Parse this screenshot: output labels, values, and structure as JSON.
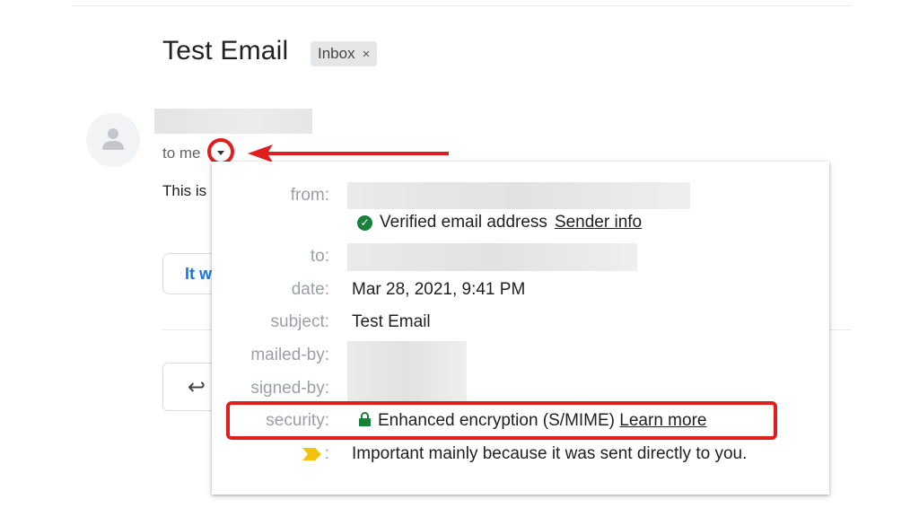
{
  "email": {
    "subject": "Test Email",
    "label_chip": "Inbox",
    "label_chip_close": "×",
    "to_me_label": "to me",
    "body_preview": "This is",
    "quick_reply_chip": "It w",
    "reply_icon_glyph": "↩"
  },
  "details": {
    "from_label": "from:",
    "verified_text": "Verified email address",
    "sender_info_link": "Sender info",
    "to_label": "to:",
    "date_label": "date:",
    "date_value": "Mar 28, 2021, 9:41 PM",
    "subject_label": "subject:",
    "subject_value": "Test Email",
    "mailed_by_label": "mailed-by:",
    "signed_by_label": "signed-by:",
    "security_label": "security:",
    "security_value": "Enhanced encryption (S/MIME)",
    "learn_more_link": "Learn more",
    "importance_colon": ":",
    "importance_text": "Important mainly because it was sent directly to you."
  },
  "colors": {
    "annotation_red": "#e01e1e",
    "verified_green": "#188038",
    "importance_yellow": "#f4c20d",
    "link_blue": "#1a73e8"
  },
  "icons": [
    "person-avatar-icon",
    "chevron-down-icon",
    "check-circle-icon",
    "lock-icon",
    "importance-marker-icon",
    "reply-icon"
  ]
}
